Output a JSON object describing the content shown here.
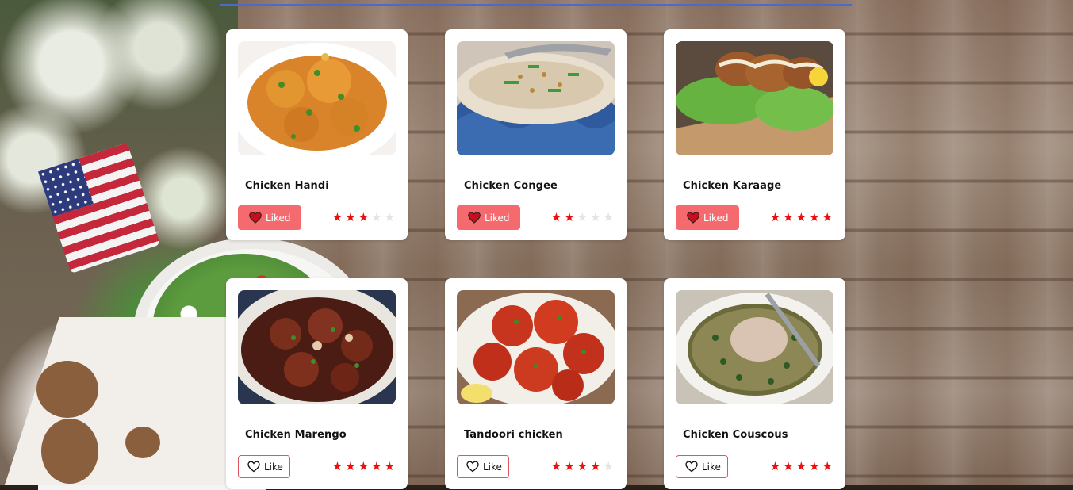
{
  "colors": {
    "liked_button_bg": "#f46a6e",
    "star_filled": "#ee0d0d",
    "star_empty": "#e4e4e4",
    "unliked_border": "#e0565c"
  },
  "recipes": [
    {
      "title": "Chicken Handi",
      "like_label": "Liked",
      "liked": true,
      "rating": 3,
      "max_rating": 5,
      "image_icon": "chicken-handi-photo"
    },
    {
      "title": "Chicken Congee",
      "like_label": "Liked",
      "liked": true,
      "rating": 2,
      "max_rating": 5,
      "image_icon": "chicken-congee-photo"
    },
    {
      "title": "Chicken Karaage",
      "like_label": "Liked",
      "liked": true,
      "rating": 5,
      "max_rating": 5,
      "image_icon": "chicken-karaage-photo"
    },
    {
      "title": "Chicken Marengo",
      "like_label": "Like",
      "liked": false,
      "rating": 5,
      "max_rating": 5,
      "image_icon": "chicken-marengo-photo"
    },
    {
      "title": "Tandoori chicken",
      "like_label": "Like",
      "liked": false,
      "rating": 4,
      "max_rating": 5,
      "image_icon": "tandoori-chicken-photo"
    },
    {
      "title": "Chicken Couscous",
      "like_label": "Like",
      "liked": false,
      "rating": 5,
      "max_rating": 5,
      "image_icon": "chicken-couscous-photo"
    }
  ]
}
